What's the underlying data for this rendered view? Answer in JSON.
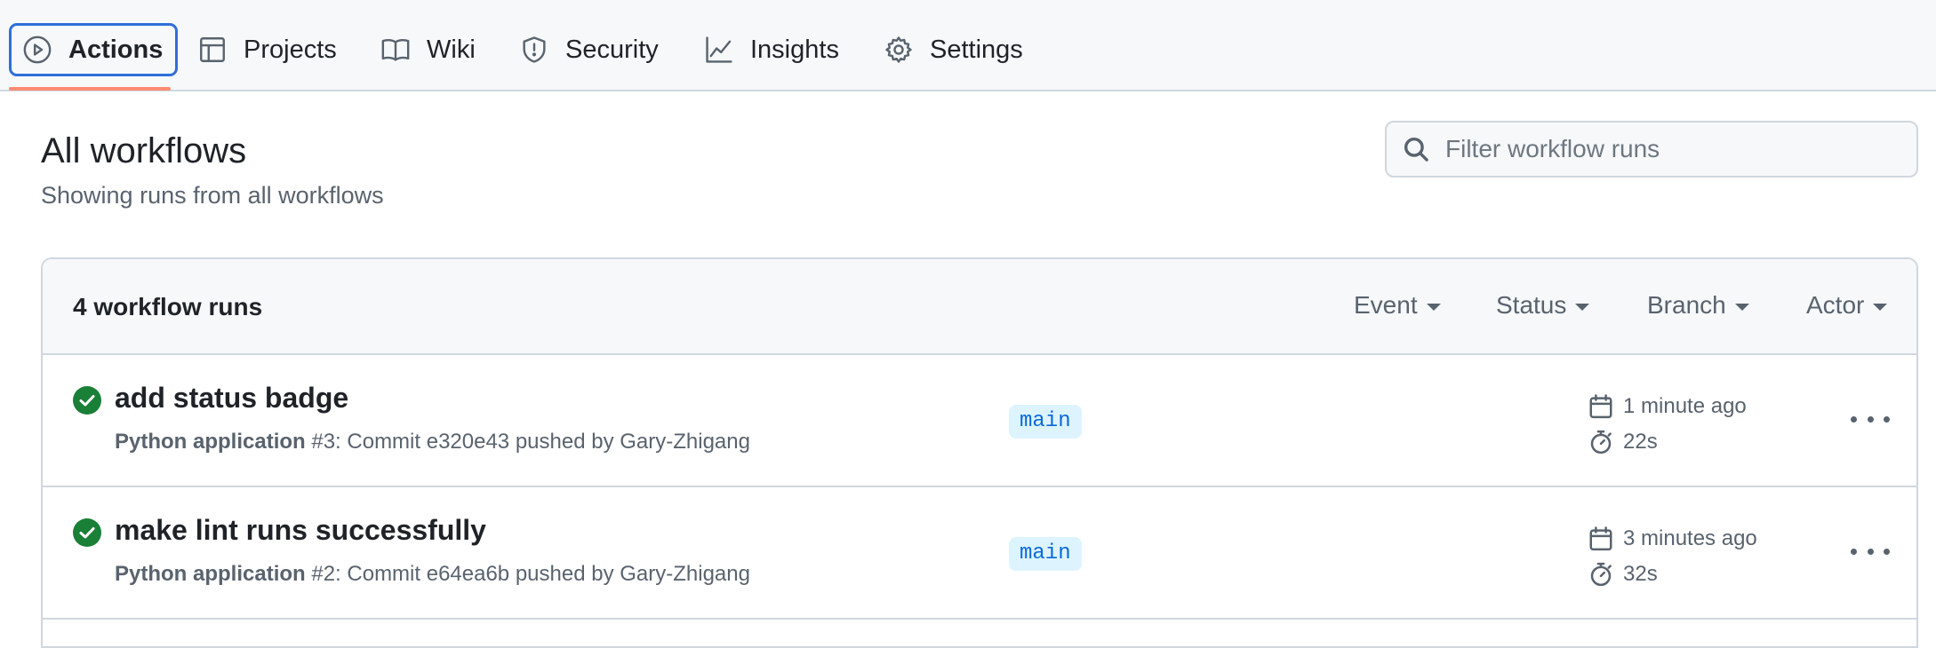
{
  "nav": {
    "items": [
      {
        "label": "Actions",
        "icon": "play-icon",
        "active": true
      },
      {
        "label": "Projects",
        "icon": "table-icon"
      },
      {
        "label": "Wiki",
        "icon": "book-icon"
      },
      {
        "label": "Security",
        "icon": "shield-icon"
      },
      {
        "label": "Insights",
        "icon": "graph-icon"
      },
      {
        "label": "Settings",
        "icon": "gear-icon"
      }
    ]
  },
  "page": {
    "title": "All workflows",
    "subtitle": "Showing runs from all workflows"
  },
  "search": {
    "placeholder": "Filter workflow runs",
    "value": ""
  },
  "runs_box": {
    "count_label": "4 workflow runs",
    "filters": [
      "Event",
      "Status",
      "Branch",
      "Actor"
    ],
    "runs": [
      {
        "title": "add status badge",
        "workflow": "Python application",
        "meta": " #3: Commit e320e43 pushed by Gary-Zhigang",
        "branch": "main",
        "when": "1 minute ago",
        "duration": "22s",
        "status": "success"
      },
      {
        "title": "make lint runs successfully",
        "workflow": "Python application",
        "meta": " #2: Commit e64ea6b pushed by Gary-Zhigang",
        "branch": "main",
        "when": "3 minutes ago",
        "duration": "32s",
        "status": "success"
      }
    ]
  },
  "colors": {
    "accent": "#2f6fd8",
    "underline": "#fd8c73",
    "success": "#1a7f37",
    "branch_bg": "#ddf4ff",
    "branch_fg": "#0969da"
  }
}
